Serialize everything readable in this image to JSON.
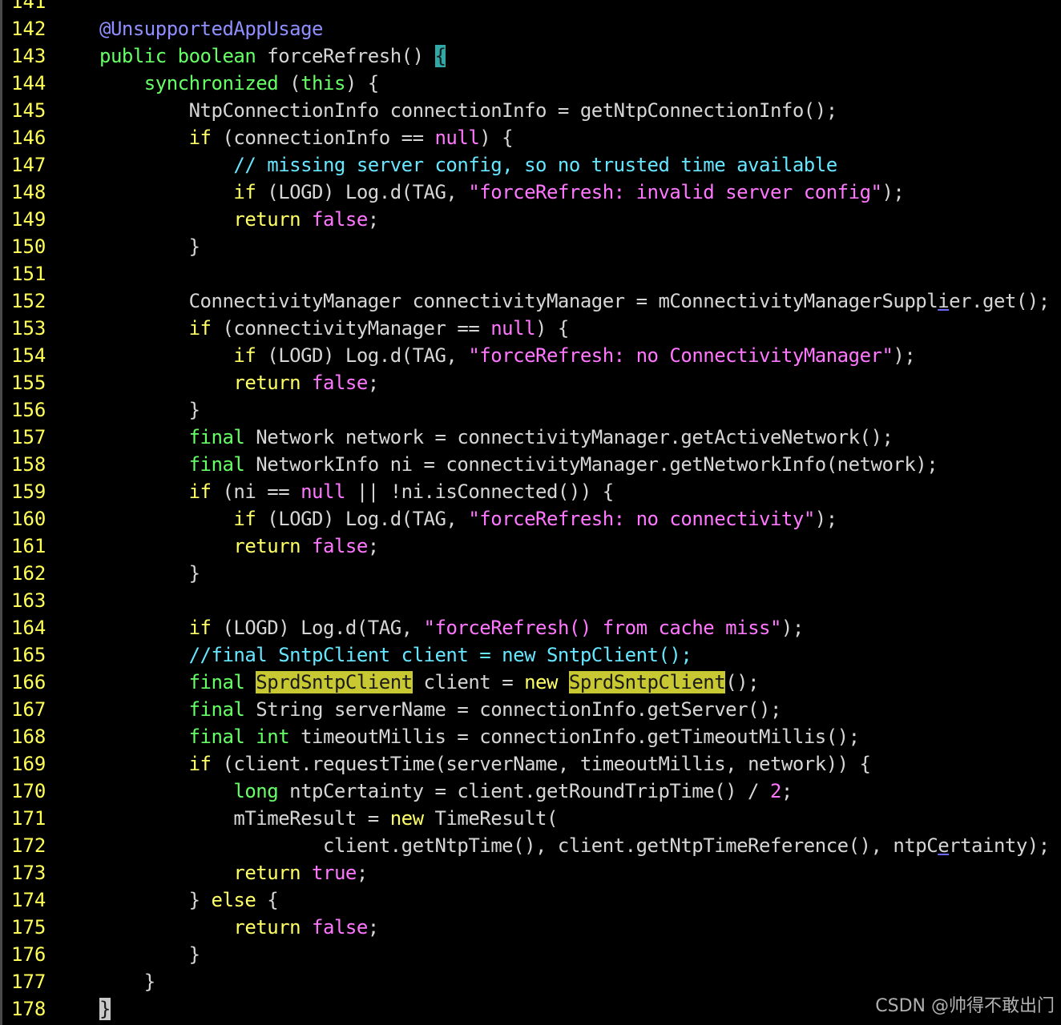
{
  "editor": {
    "lines": [
      {
        "num": "141",
        "tokens": []
      },
      {
        "num": "142",
        "tokens": [
          [
            "ann",
            "@UnsupportedAppUsage"
          ]
        ]
      },
      {
        "num": "143",
        "tokens": [
          [
            "type",
            "public"
          ],
          [
            "plain",
            " "
          ],
          [
            "type",
            "boolean"
          ],
          [
            "plain",
            " forceRefresh() "
          ],
          [
            "cursor-teal",
            "{"
          ]
        ]
      },
      {
        "num": "144",
        "tokens": [
          [
            "plain",
            "    "
          ],
          [
            "type",
            "synchronized"
          ],
          [
            "plain",
            " ("
          ],
          [
            "type",
            "this"
          ],
          [
            "plain",
            ") {"
          ]
        ]
      },
      {
        "num": "145",
        "tokens": [
          [
            "plain",
            "        NtpConnectionInfo connectionInfo = getNtpConnectionInfo();"
          ]
        ]
      },
      {
        "num": "146",
        "tokens": [
          [
            "plain",
            "        "
          ],
          [
            "kw",
            "if"
          ],
          [
            "plain",
            " (connectionInfo == "
          ],
          [
            "str",
            "null"
          ],
          [
            "plain",
            ") {"
          ]
        ]
      },
      {
        "num": "147",
        "tokens": [
          [
            "plain",
            "            "
          ],
          [
            "com",
            "// missing server config, so no trusted time available"
          ]
        ]
      },
      {
        "num": "148",
        "tokens": [
          [
            "plain",
            "            "
          ],
          [
            "kw",
            "if"
          ],
          [
            "plain",
            " (LOGD) Log.d(TAG, "
          ],
          [
            "str",
            "\"forceRefresh: invalid server config\""
          ],
          [
            "plain",
            ");"
          ]
        ]
      },
      {
        "num": "149",
        "tokens": [
          [
            "plain",
            "            "
          ],
          [
            "kw",
            "return"
          ],
          [
            "plain",
            " "
          ],
          [
            "str",
            "false"
          ],
          [
            "plain",
            ";"
          ]
        ]
      },
      {
        "num": "150",
        "tokens": [
          [
            "plain",
            "        }"
          ]
        ]
      },
      {
        "num": "151",
        "tokens": []
      },
      {
        "num": "152",
        "tokens": [
          [
            "plain",
            "        ConnectivityManager connectivityManager = mConnectivityManagerSuppl"
          ],
          [
            "ul",
            "i"
          ],
          [
            "plain",
            "er.get();"
          ]
        ]
      },
      {
        "num": "153",
        "tokens": [
          [
            "plain",
            "        "
          ],
          [
            "kw",
            "if"
          ],
          [
            "plain",
            " (connectivityManager == "
          ],
          [
            "str",
            "null"
          ],
          [
            "plain",
            ") {"
          ]
        ]
      },
      {
        "num": "154",
        "tokens": [
          [
            "plain",
            "            "
          ],
          [
            "kw",
            "if"
          ],
          [
            "plain",
            " (LOGD) Log.d(TAG, "
          ],
          [
            "str",
            "\"forceRefresh: no ConnectivityManager\""
          ],
          [
            "plain",
            ");"
          ]
        ]
      },
      {
        "num": "155",
        "tokens": [
          [
            "plain",
            "            "
          ],
          [
            "kw",
            "return"
          ],
          [
            "plain",
            " "
          ],
          [
            "str",
            "false"
          ],
          [
            "plain",
            ";"
          ]
        ]
      },
      {
        "num": "156",
        "tokens": [
          [
            "plain",
            "        }"
          ]
        ]
      },
      {
        "num": "157",
        "tokens": [
          [
            "plain",
            "        "
          ],
          [
            "type",
            "final"
          ],
          [
            "plain",
            " Network network = connectivityManager.getActiveNetwork();"
          ]
        ]
      },
      {
        "num": "158",
        "tokens": [
          [
            "plain",
            "        "
          ],
          [
            "type",
            "final"
          ],
          [
            "plain",
            " NetworkInfo ni = connectivityManager.getNetworkInfo(network);"
          ]
        ]
      },
      {
        "num": "159",
        "tokens": [
          [
            "plain",
            "        "
          ],
          [
            "kw",
            "if"
          ],
          [
            "plain",
            " (ni == "
          ],
          [
            "str",
            "null"
          ],
          [
            "plain",
            " || !ni.isConnected()) {"
          ]
        ]
      },
      {
        "num": "160",
        "tokens": [
          [
            "plain",
            "            "
          ],
          [
            "kw",
            "if"
          ],
          [
            "plain",
            " (LOGD) Log.d(TAG, "
          ],
          [
            "str",
            "\"forceRefresh: no connectivity\""
          ],
          [
            "plain",
            ");"
          ]
        ]
      },
      {
        "num": "161",
        "tokens": [
          [
            "plain",
            "            "
          ],
          [
            "kw",
            "return"
          ],
          [
            "plain",
            " "
          ],
          [
            "str",
            "false"
          ],
          [
            "plain",
            ";"
          ]
        ]
      },
      {
        "num": "162",
        "tokens": [
          [
            "plain",
            "        }"
          ]
        ]
      },
      {
        "num": "163",
        "tokens": []
      },
      {
        "num": "164",
        "tokens": [
          [
            "plain",
            "        "
          ],
          [
            "kw",
            "if"
          ],
          [
            "plain",
            " (LOGD) Log.d(TAG, "
          ],
          [
            "str",
            "\"forceRefresh() from cache miss\""
          ],
          [
            "plain",
            ");"
          ]
        ]
      },
      {
        "num": "165",
        "tokens": [
          [
            "plain",
            "        "
          ],
          [
            "com",
            "//final SntpClient client = new SntpClient();"
          ]
        ]
      },
      {
        "num": "166",
        "tokens": [
          [
            "plain",
            "        "
          ],
          [
            "type",
            "final"
          ],
          [
            "plain",
            " "
          ],
          [
            "hl",
            "SprdSntpClient"
          ],
          [
            "plain",
            " client = "
          ],
          [
            "kw",
            "new"
          ],
          [
            "plain",
            " "
          ],
          [
            "hl",
            "SprdSntpClient"
          ],
          [
            "plain",
            "();"
          ]
        ]
      },
      {
        "num": "167",
        "tokens": [
          [
            "plain",
            "        "
          ],
          [
            "type",
            "final"
          ],
          [
            "plain",
            " String serverName = connectionInfo.getServer();"
          ]
        ]
      },
      {
        "num": "168",
        "tokens": [
          [
            "plain",
            "        "
          ],
          [
            "type",
            "final"
          ],
          [
            "plain",
            " "
          ],
          [
            "type",
            "int"
          ],
          [
            "plain",
            " timeoutMillis = connectionInfo.getTimeoutMillis();"
          ]
        ]
      },
      {
        "num": "169",
        "tokens": [
          [
            "plain",
            "        "
          ],
          [
            "kw",
            "if"
          ],
          [
            "plain",
            " (client.requestTime(serverName, timeoutMillis, network)) {"
          ]
        ]
      },
      {
        "num": "170",
        "tokens": [
          [
            "plain",
            "            "
          ],
          [
            "type",
            "long"
          ],
          [
            "plain",
            " ntpCertainty = client.getRoundTripTime() / "
          ],
          [
            "num",
            "2"
          ],
          [
            "plain",
            ";"
          ]
        ]
      },
      {
        "num": "171",
        "tokens": [
          [
            "plain",
            "            mTimeResult = "
          ],
          [
            "kw",
            "new"
          ],
          [
            "plain",
            " TimeResult("
          ]
        ]
      },
      {
        "num": "172",
        "tokens": [
          [
            "plain",
            "                    client.getNtpTime(), client.getNtpTimeReference(), ntpC"
          ],
          [
            "ul",
            "e"
          ],
          [
            "plain",
            "rtainty);"
          ]
        ]
      },
      {
        "num": "173",
        "tokens": [
          [
            "plain",
            "            "
          ],
          [
            "kw",
            "return"
          ],
          [
            "plain",
            " "
          ],
          [
            "str",
            "true"
          ],
          [
            "plain",
            ";"
          ]
        ]
      },
      {
        "num": "174",
        "tokens": [
          [
            "plain",
            "        } "
          ],
          [
            "kw",
            "else"
          ],
          [
            "plain",
            " {"
          ]
        ]
      },
      {
        "num": "175",
        "tokens": [
          [
            "plain",
            "            "
          ],
          [
            "kw",
            "return"
          ],
          [
            "plain",
            " "
          ],
          [
            "str",
            "false"
          ],
          [
            "plain",
            ";"
          ]
        ]
      },
      {
        "num": "176",
        "tokens": [
          [
            "plain",
            "        }"
          ]
        ]
      },
      {
        "num": "177",
        "tokens": [
          [
            "plain",
            "    }"
          ]
        ]
      },
      {
        "num": "178",
        "tokens": [
          [
            "cursor-block",
            "}"
          ]
        ]
      }
    ]
  },
  "watermark": "CSDN @帅得不敢出门"
}
